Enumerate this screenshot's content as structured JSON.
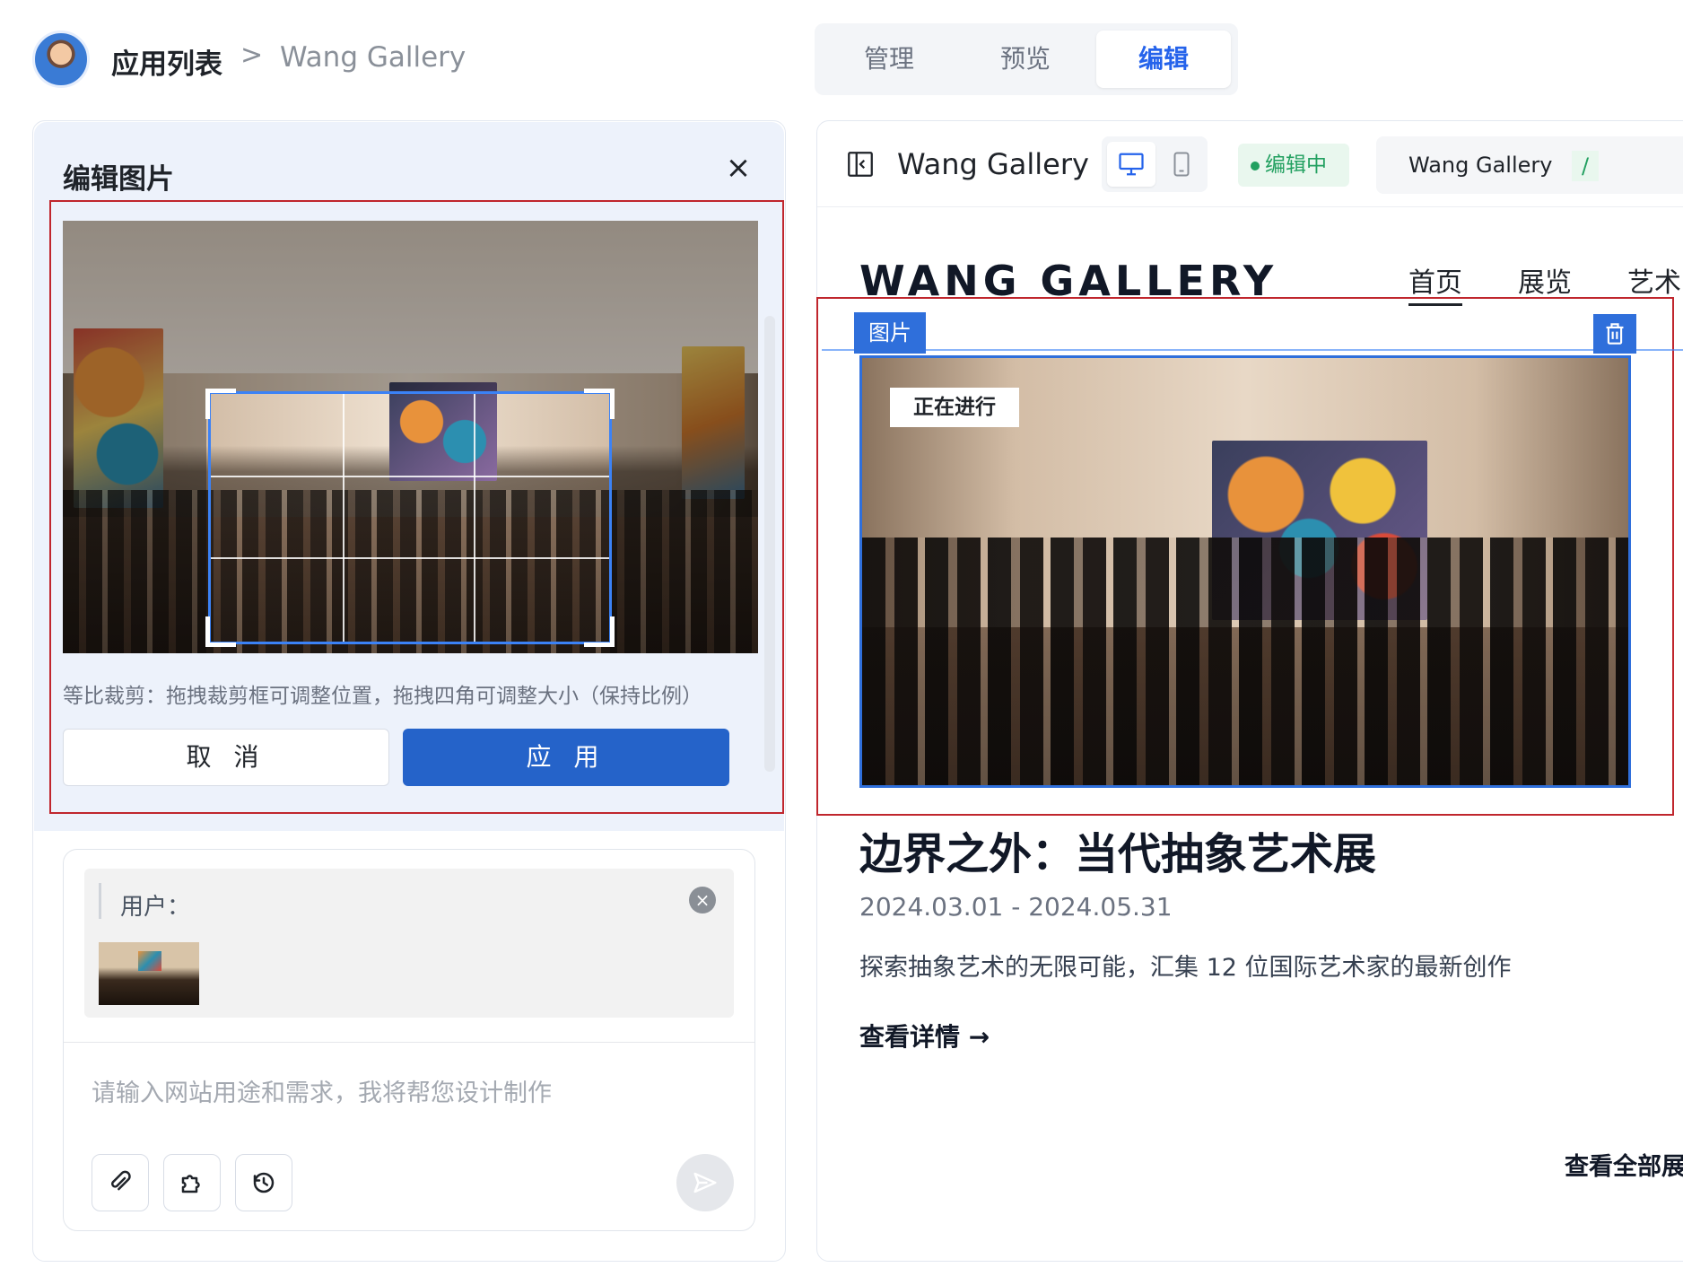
{
  "breadcrumb": {
    "root": "应用列表",
    "separator": ">",
    "current": "Wang Gallery"
  },
  "mode_tabs": [
    {
      "label": "管理",
      "active": false
    },
    {
      "label": "预览",
      "active": false
    },
    {
      "label": "编辑",
      "active": true
    }
  ],
  "editor": {
    "title": "编辑图片",
    "close_icon": "close-icon",
    "hint": "等比裁剪：拖拽裁剪框可调整位置，拖拽四角可调整大小（保持比例）",
    "cancel_label": "取 消",
    "apply_label": "应 用"
  },
  "chat": {
    "user_label": "用户：",
    "input_placeholder": "请输入网站用途和需求，我将帮您设计制作",
    "tools": [
      "paperclip-icon",
      "plugin-icon",
      "history-icon"
    ],
    "send_icon": "send-icon"
  },
  "preview_toolbar": {
    "site_name": "Wang Gallery",
    "devices": [
      {
        "icon": "desktop-icon",
        "active": true
      },
      {
        "icon": "mobile-icon",
        "active": false
      }
    ],
    "status": "编辑中",
    "url_site": "Wang Gallery",
    "url_path": "/"
  },
  "site": {
    "brand": "WANG GALLERY",
    "nav": [
      {
        "label": "首页",
        "active": true
      },
      {
        "label": "展览",
        "active": false
      },
      {
        "label": "艺术",
        "active": false
      }
    ],
    "image_block_label": "图片",
    "hero_tag": "正在进行",
    "exhibit_title": "边界之外：当代抽象艺术展",
    "exhibit_date": "2024.03.01 - 2024.05.31",
    "exhibit_desc": "探索抽象艺术的无限可能，汇集 12 位国际艺术家的最新创作",
    "detail_link": "查看详情",
    "view_all": "查看全部展"
  },
  "colors": {
    "accent": "#2563c9",
    "selection": "#2f6fdb",
    "status_green": "#22a060",
    "highlight_red": "#c0262d"
  }
}
